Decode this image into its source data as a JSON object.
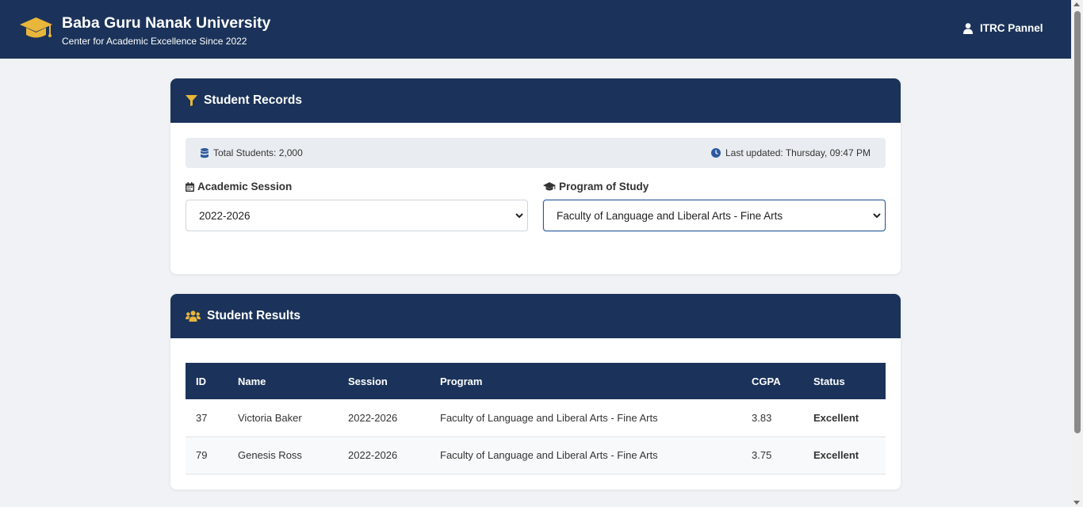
{
  "navbar": {
    "title": "Baba Guru Nanak University",
    "subtitle": "Center for Academic Excellence Since 2022",
    "panel_label": "ITRC Pannel"
  },
  "records_card": {
    "title": "Student Records",
    "total_students": "Total Students: 2,000",
    "last_updated": "Last updated: Thursday, 09:47 PM",
    "session_label": "Academic Session",
    "session_value": "2022-2026",
    "program_label": "Program of Study",
    "program_value": "Faculty of Language and Liberal Arts - Fine Arts"
  },
  "results_card": {
    "title": "Student Results",
    "columns": [
      "ID",
      "Name",
      "Session",
      "Program",
      "CGPA",
      "Status"
    ],
    "rows": [
      [
        "37",
        "Victoria Baker",
        "2022-2026",
        "Faculty of Language and Liberal Arts - Fine Arts",
        "3.83",
        "Excellent"
      ],
      [
        "79",
        "Genesis Ross",
        "2022-2026",
        "Faculty of Language and Liberal Arts - Fine Arts",
        "3.75",
        "Excellent"
      ]
    ]
  },
  "icons": {
    "brand": "graduation-cap-icon",
    "panel": "user-icon",
    "records": "filter-icon",
    "total": "database-icon",
    "updated": "clock-icon",
    "session": "calendar-icon",
    "program": "graduation-cap-icon",
    "results": "users-icon"
  },
  "colors": {
    "primary": "#1b335a",
    "accent": "#e8b63a",
    "status_excellent": "#2e8b44",
    "info_icon": "#2c5a9e"
  }
}
